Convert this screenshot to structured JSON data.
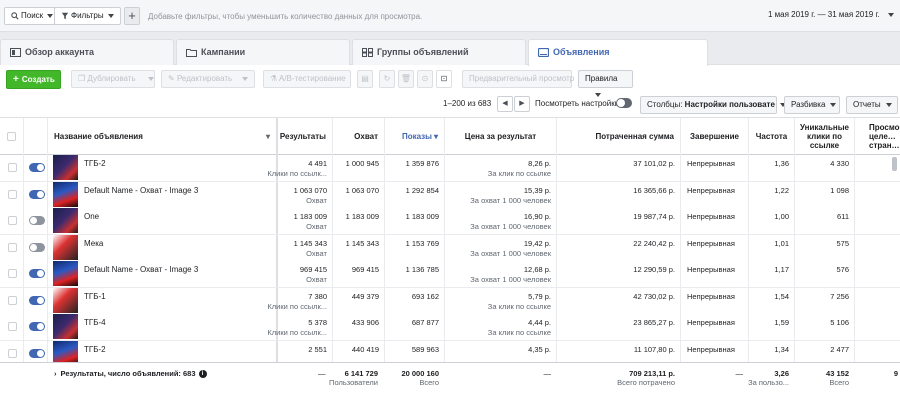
{
  "filterbar": {
    "search_label": "Поиск",
    "filters_label": "Фильтры",
    "plus": "+",
    "hint": "Добавьте фильтры, чтобы уменьшить количество данных для просмотра.",
    "date_range": "1 мая 2019 г. — 31 мая 2019 г."
  },
  "tabs": [
    {
      "label": "Обзор аккаунта",
      "icon": "account-icon"
    },
    {
      "label": "Кампании",
      "icon": "folder-icon"
    },
    {
      "label": "Группы объявлений",
      "icon": "grid-icon"
    },
    {
      "label": "Объявления",
      "icon": "ad-icon",
      "active": true
    }
  ],
  "toolbar": {
    "create": "Создать",
    "duplicate": "Дублировать",
    "edit": "Редактировать",
    "ab_test": "A/B-тестирование",
    "preview": "Предварительный просмотр",
    "rules": "Правила"
  },
  "pagination": {
    "range": "1–200 из 683",
    "view_settings": "Посмотреть настройки",
    "columns_label": "Столбцы:",
    "columns_value": "Настройки пользовате",
    "breakdown": "Разбивка",
    "reports": "Отчеты"
  },
  "columns": {
    "name": "Название объявления",
    "results": "Результаты",
    "reach": "Охват",
    "impressions": "Показы",
    "cost_per_result": "Цена за результат",
    "spent": "Потраченная сумма",
    "ends": "Завершение",
    "frequency": "Частота",
    "unique_clicks": "Уникальные клики по ссылке",
    "views": "Просмо… целе… стран…"
  },
  "rows": [
    {
      "on": true,
      "name": "ТГБ-2",
      "results": "4 491",
      "results_sub": "Клики по ссылк...",
      "reach": "1 000 945",
      "impr": "1 359 876",
      "cpr": "8,26 р.",
      "cpr_sub": "За клик по ссылке",
      "spent": "37 101,02 р.",
      "ends": "Непрерывная",
      "freq": "1,36",
      "uclicks": "4 330"
    },
    {
      "on": true,
      "name": "Default Name - Охват - Image 3",
      "results": "1 063 070",
      "results_sub": "Охват",
      "reach": "1 063 070",
      "impr": "1 292 854",
      "cpr": "15,39 р.",
      "cpr_sub": "За охват 1 000 человек",
      "spent": "16 365,66 р.",
      "ends": "Непрерывная",
      "freq": "1,22",
      "uclicks": "1 098"
    },
    {
      "on": false,
      "name": "One",
      "results": "1 183 009",
      "results_sub": "Охват",
      "reach": "1 183 009",
      "impr": "1 183 009",
      "cpr": "16,90 р.",
      "cpr_sub": "За охват 1 000 человек",
      "spent": "19 987,74 р.",
      "ends": "Непрерывная",
      "freq": "1,00",
      "uclicks": "611"
    },
    {
      "on": false,
      "name": "Мека",
      "results": "1 145 343",
      "results_sub": "Охват",
      "reach": "1 145 343",
      "impr": "1 153 769",
      "cpr": "19,42 р.",
      "cpr_sub": "За охват 1 000 человек",
      "spent": "22 240,42 р.",
      "ends": "Непрерывная",
      "freq": "1,01",
      "uclicks": "575"
    },
    {
      "on": true,
      "name": "Default Name - Охват - Image 3",
      "results": "969 415",
      "results_sub": "Охват",
      "reach": "969 415",
      "impr": "1 136 785",
      "cpr": "12,68 р.",
      "cpr_sub": "За охват 1 000 человек",
      "spent": "12 290,59 р.",
      "ends": "Непрерывная",
      "freq": "1,17",
      "uclicks": "576"
    },
    {
      "on": true,
      "name": "ТГБ-1",
      "results": "7 380",
      "results_sub": "Клики по ссылк...",
      "reach": "449 379",
      "impr": "693 162",
      "cpr": "5,79 р.",
      "cpr_sub": "За клик по ссылке",
      "spent": "42 730,02 р.",
      "ends": "Непрерывная",
      "freq": "1,54",
      "uclicks": "7 256"
    },
    {
      "on": true,
      "name": "ТГБ-4",
      "results": "5 378",
      "results_sub": "Клики по ссылк...",
      "reach": "433 906",
      "impr": "687 877",
      "cpr": "4,44 р.",
      "cpr_sub": "За клик по ссылке",
      "spent": "23 865,27 р.",
      "ends": "Непрерывная",
      "freq": "1,59",
      "uclicks": "5 106"
    },
    {
      "on": true,
      "name": "ТГБ-2",
      "results": "2 551",
      "results_sub": "",
      "reach": "440 419",
      "impr": "589 963",
      "cpr": "4,35 р.",
      "cpr_sub": "",
      "spent": "11 107,80 р.",
      "ends": "Непрерывная",
      "freq": "1,34",
      "uclicks": "2 477"
    }
  ],
  "footer": {
    "label": "Результаты, число объявлений: 683",
    "results": "—",
    "reach": "6 141 729",
    "reach_sub": "Пользователи",
    "impr": "20 000 160",
    "impr_sub": "Всего",
    "cpr": "—",
    "spent": "709 213,11 р.",
    "spent_sub": "Всего потрачено",
    "ends": "—",
    "freq": "3,26",
    "freq_sub": "За пользо...",
    "uclicks": "43 152",
    "uclicks_sub": "Всего",
    "views": "9"
  }
}
